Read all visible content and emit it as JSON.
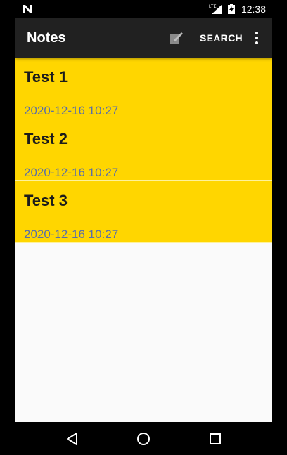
{
  "status_bar": {
    "network_label": "LTE",
    "time": "12:38"
  },
  "toolbar": {
    "title": "Notes",
    "search_label": "SEARCH"
  },
  "notes": [
    {
      "title": "Test 1",
      "date": "2020-12-16 10:27"
    },
    {
      "title": "Test 2",
      "date": "2020-12-16 10:27"
    },
    {
      "title": "Test 3",
      "date": "2020-12-16 10:27"
    }
  ],
  "colors": {
    "note_background": "#FFD600",
    "toolbar_background": "#212121",
    "date_text": "#5a6fa8"
  },
  "icons": {
    "status_left": "n-notification-icon",
    "compose": "compose-icon",
    "overflow": "more-vert-icon",
    "back": "back-triangle-icon",
    "home": "home-circle-icon",
    "recents": "recents-square-icon"
  }
}
